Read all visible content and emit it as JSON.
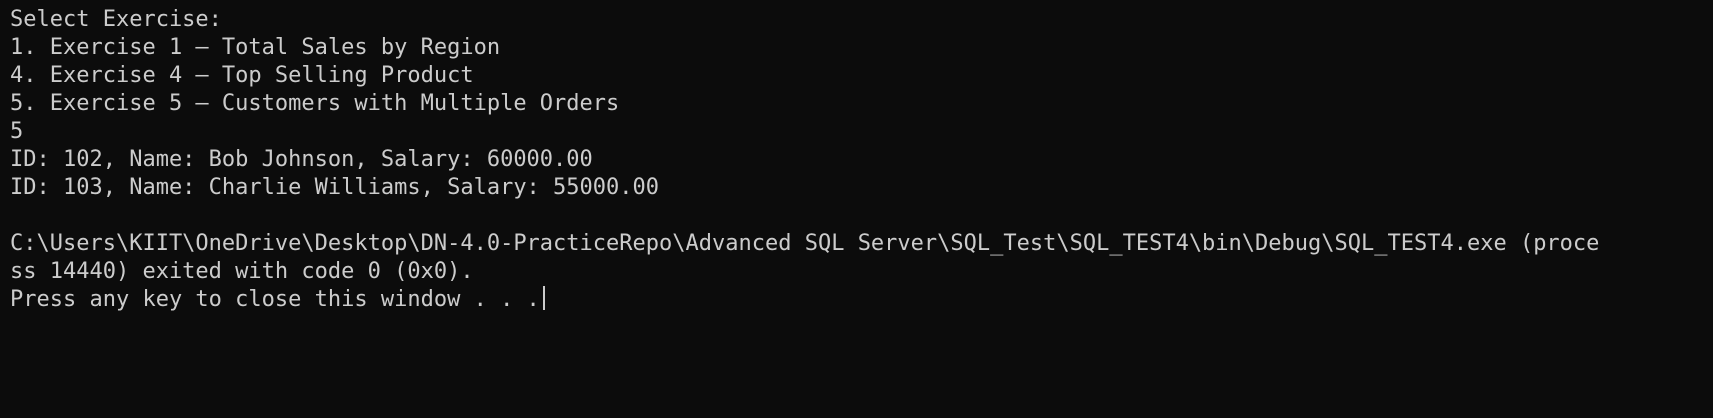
{
  "console": {
    "lines": [
      "Select Exercise:",
      "1. Exercise 1 – Total Sales by Region",
      "4. Exercise 4 – Top Selling Product",
      "5. Exercise 5 – Customers with Multiple Orders",
      "5",
      "ID: 102, Name: Bob Johnson, Salary: 60000.00",
      "ID: 103, Name: Charlie Williams, Salary: 55000.00",
      "",
      "C:\\Users\\KIIT\\OneDrive\\Desktop\\DN-4.0-PracticeRepo\\Advanced SQL Server\\SQL_Test\\SQL_TEST4\\bin\\Debug\\SQL_TEST4.exe (proce",
      "ss 14440) exited with code 0 (0x0).",
      "Press any key to close this window . . ."
    ],
    "colors": {
      "background": "#0c0c0c",
      "foreground": "#cccccc"
    }
  }
}
